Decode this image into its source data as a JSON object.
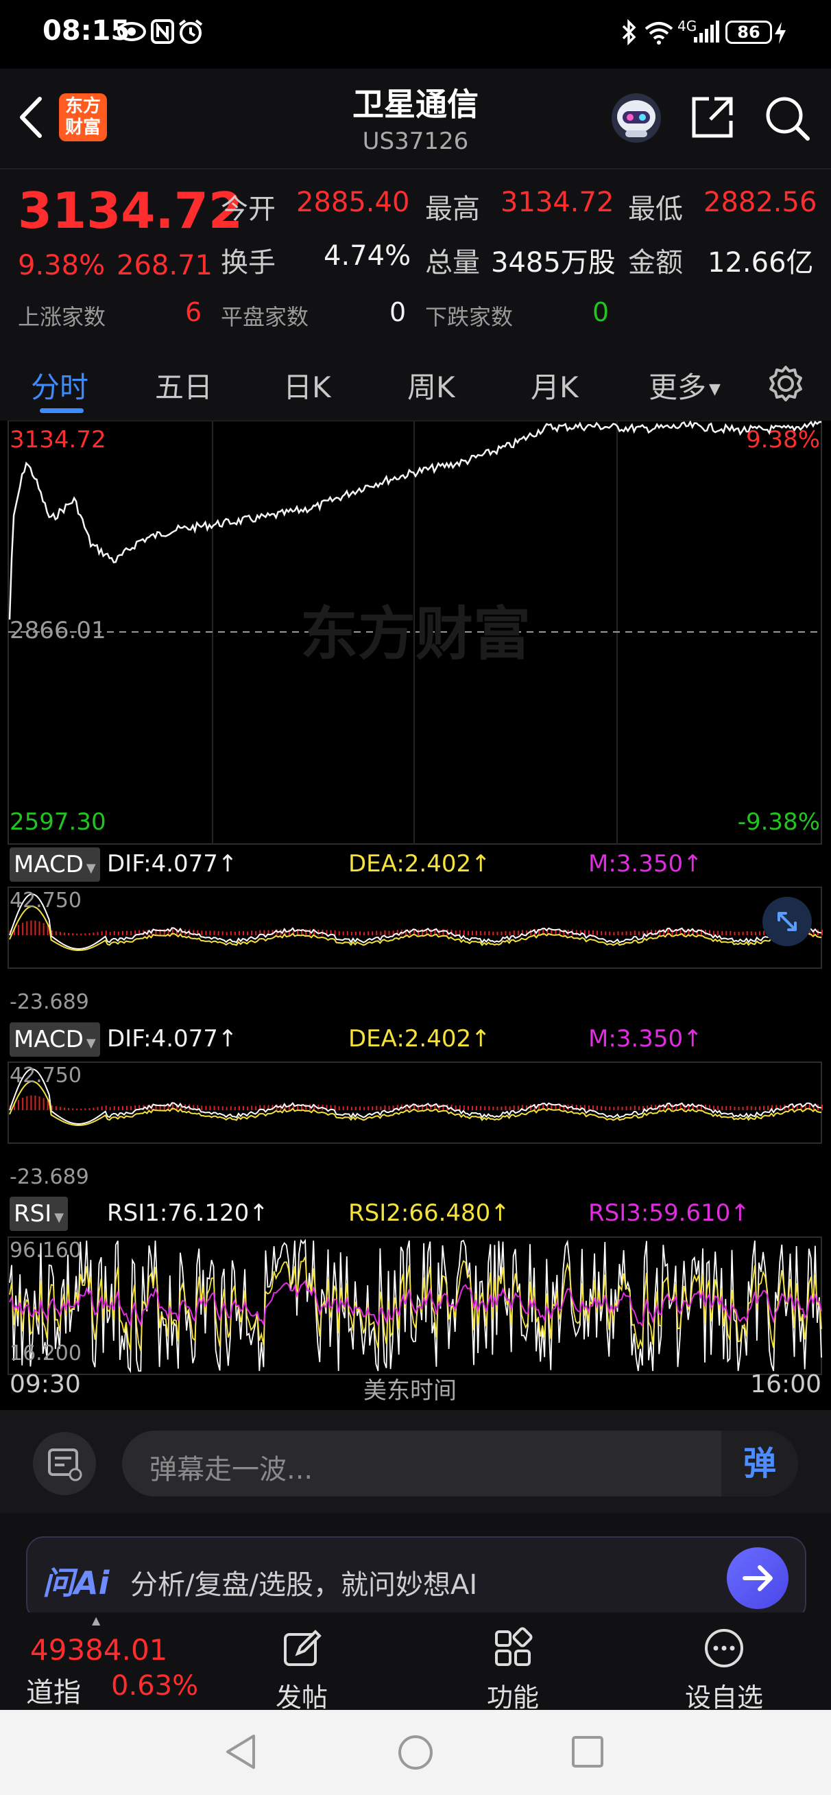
{
  "status_bar": {
    "time": "08:15",
    "network": "4G",
    "battery": "86"
  },
  "header": {
    "back_icon": "chevron-left-icon",
    "logo_text": [
      "东方",
      "财富"
    ],
    "title": "卫星通信",
    "subtitle": "US37126",
    "icons": [
      "robot-avatar-icon",
      "share-icon",
      "search-icon"
    ]
  },
  "quote": {
    "price": "3134.72",
    "change_pct": "9.38%",
    "change_abs": "268.71",
    "open_label": "今开",
    "open": "2885.40",
    "high_label": "最高",
    "high": "3134.72",
    "low_label": "最低",
    "low": "2882.56",
    "turnover_label": "换手",
    "turnover": "4.74%",
    "volume_label": "总量",
    "volume": "3485万股",
    "amount_label": "金额",
    "amount": "12.66亿",
    "up_label": "上涨家数",
    "up_count": "6",
    "flat_label": "平盘家数",
    "flat_count": "0",
    "down_label": "下跌家数",
    "down_count": "0",
    "colors": {
      "up": "#ff2d2d",
      "down": "#22c51f"
    }
  },
  "tabs": {
    "items": [
      "分时",
      "五日",
      "日K",
      "周K",
      "月K",
      "更多"
    ],
    "active": "分时",
    "settings_icon": "gear-icon",
    "accent": "#3d8bff"
  },
  "chart": {
    "price_top": "3134.72",
    "price_mid": "2866.01",
    "price_bottom": "2597.30",
    "pct_top": "9.38%",
    "pct_bottom": "-9.38%",
    "watermark": "东方财富",
    "macd1": {
      "name": "MACD",
      "dif": "DIF:4.077",
      "dea": "DEA:2.402",
      "m": "M:3.350",
      "max": "42.750",
      "min": "-23.689"
    },
    "macd2": {
      "name": "MACD",
      "dif": "DIF:4.077",
      "dea": "DEA:2.402",
      "m": "M:3.350",
      "max": "42.750",
      "min": "-23.689"
    },
    "rsi": {
      "name": "RSI",
      "rsi1": "RSI1:76.120",
      "rsi2": "RSI2:66.480",
      "rsi3": "RSI3:59.610",
      "max": "96.160",
      "min": "16.200"
    },
    "time_start": "09:30",
    "time_label": "美东时间",
    "time_end": "16:00"
  },
  "danmu": {
    "placeholder": "弹幕走一波...",
    "send_label": "弹"
  },
  "ai_bar": {
    "brand": "问Ai",
    "prompt": "分析/复盘/选股，就问妙想AI"
  },
  "bottom_nav": {
    "index_value": "49384.01",
    "index_name": "道指",
    "index_pct": "0.63%",
    "items": [
      {
        "label": "发帖",
        "icon": "edit-icon"
      },
      {
        "label": "功能",
        "icon": "grid-icon"
      },
      {
        "label": "设自选",
        "icon": "more-circle-icon"
      }
    ]
  }
}
